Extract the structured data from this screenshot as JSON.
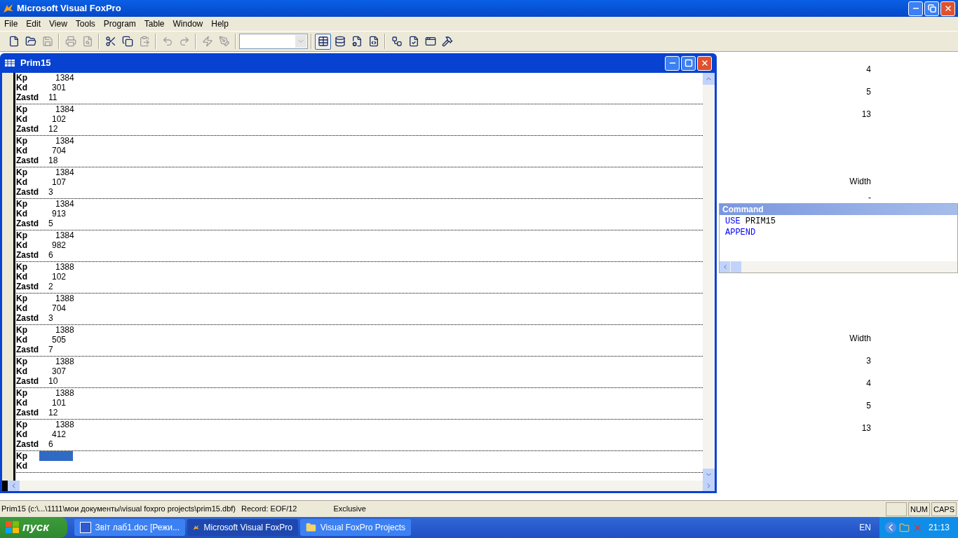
{
  "window": {
    "title": "Microsoft Visual FoxPro"
  },
  "menu": [
    "File",
    "Edit",
    "View",
    "Tools",
    "Program",
    "Table",
    "Window",
    "Help"
  ],
  "toolbar": [
    {
      "kind": "new",
      "disabled": false,
      "pressed": false
    },
    {
      "kind": "open",
      "disabled": false,
      "pressed": false
    },
    {
      "kind": "save",
      "disabled": true,
      "pressed": false
    },
    {
      "kind": "sep"
    },
    {
      "kind": "print",
      "disabled": true,
      "pressed": false
    },
    {
      "kind": "preview",
      "disabled": true,
      "pressed": false
    },
    {
      "kind": "sep"
    },
    {
      "kind": "cut",
      "disabled": false,
      "pressed": false
    },
    {
      "kind": "copy",
      "disabled": false,
      "pressed": false
    },
    {
      "kind": "paste",
      "disabled": true,
      "pressed": false
    },
    {
      "kind": "sep"
    },
    {
      "kind": "undo",
      "disabled": true,
      "pressed": false
    },
    {
      "kind": "redo",
      "disabled": true,
      "pressed": false
    },
    {
      "kind": "sep"
    },
    {
      "kind": "run",
      "disabled": true,
      "pressed": false
    },
    {
      "kind": "modify",
      "disabled": true,
      "pressed": false
    },
    {
      "kind": "sep"
    },
    {
      "kind": "combo"
    },
    {
      "kind": "sep"
    },
    {
      "kind": "grid",
      "disabled": false,
      "pressed": true
    },
    {
      "kind": "database",
      "disabled": false,
      "pressed": false
    },
    {
      "kind": "properties",
      "disabled": false,
      "pressed": false
    },
    {
      "kind": "code",
      "disabled": false,
      "pressed": false
    },
    {
      "kind": "sep"
    },
    {
      "kind": "wizard",
      "disabled": false,
      "pressed": false
    },
    {
      "kind": "form",
      "disabled": false,
      "pressed": false
    },
    {
      "kind": "report",
      "disabled": false,
      "pressed": false
    },
    {
      "kind": "tools",
      "disabled": false,
      "pressed": false
    }
  ],
  "browse": {
    "title": "Prim15",
    "records": [
      {
        "fields": [
          {
            "name": "Kp",
            "value": "1384",
            "selected": false
          },
          {
            "name": "Kd",
            "value": "301",
            "selected": false
          },
          {
            "name": "Zastd",
            "value": "11",
            "selected": false
          }
        ]
      },
      {
        "fields": [
          {
            "name": "Kp",
            "value": "1384",
            "selected": false
          },
          {
            "name": "Kd",
            "value": "102",
            "selected": false
          },
          {
            "name": "Zastd",
            "value": "12",
            "selected": false
          }
        ]
      },
      {
        "fields": [
          {
            "name": "Kp",
            "value": "1384",
            "selected": false
          },
          {
            "name": "Kd",
            "value": "704",
            "selected": false
          },
          {
            "name": "Zastd",
            "value": "18",
            "selected": false
          }
        ]
      },
      {
        "fields": [
          {
            "name": "Kp",
            "value": "1384",
            "selected": false
          },
          {
            "name": "Kd",
            "value": "107",
            "selected": false
          },
          {
            "name": "Zastd",
            "value": "3",
            "selected": false
          }
        ]
      },
      {
        "fields": [
          {
            "name": "Kp",
            "value": "1384",
            "selected": false
          },
          {
            "name": "Kd",
            "value": "913",
            "selected": false
          },
          {
            "name": "Zastd",
            "value": "5",
            "selected": false
          }
        ]
      },
      {
        "fields": [
          {
            "name": "Kp",
            "value": "1384",
            "selected": false
          },
          {
            "name": "Kd",
            "value": "982",
            "selected": false
          },
          {
            "name": "Zastd",
            "value": "6",
            "selected": false
          }
        ]
      },
      {
        "fields": [
          {
            "name": "Kp",
            "value": "1388",
            "selected": false
          },
          {
            "name": "Kd",
            "value": "102",
            "selected": false
          },
          {
            "name": "Zastd",
            "value": "2",
            "selected": false
          }
        ]
      },
      {
        "fields": [
          {
            "name": "Kp",
            "value": "1388",
            "selected": false
          },
          {
            "name": "Kd",
            "value": "704",
            "selected": false
          },
          {
            "name": "Zastd",
            "value": "3",
            "selected": false
          }
        ]
      },
      {
        "fields": [
          {
            "name": "Kp",
            "value": "1388",
            "selected": false
          },
          {
            "name": "Kd",
            "value": "505",
            "selected": false
          },
          {
            "name": "Zastd",
            "value": "7",
            "selected": false
          }
        ]
      },
      {
        "fields": [
          {
            "name": "Kp",
            "value": "1388",
            "selected": false
          },
          {
            "name": "Kd",
            "value": "307",
            "selected": false
          },
          {
            "name": "Zastd",
            "value": "10",
            "selected": false
          }
        ]
      },
      {
        "fields": [
          {
            "name": "Kp",
            "value": "1388",
            "selected": false
          },
          {
            "name": "Kd",
            "value": "101",
            "selected": false
          },
          {
            "name": "Zastd",
            "value": "12",
            "selected": false
          }
        ]
      },
      {
        "fields": [
          {
            "name": "Kp",
            "value": "1388",
            "selected": false
          },
          {
            "name": "Kd",
            "value": "412",
            "selected": false
          },
          {
            "name": "Zastd",
            "value": "6",
            "selected": false
          }
        ]
      },
      {
        "fields": [
          {
            "name": "Kp",
            "selected": true
          },
          {
            "name": "Kd",
            "selected": false
          }
        ]
      }
    ]
  },
  "background_upper": [
    {
      "text": "4",
      "kind": "value"
    },
    {
      "text": "5",
      "kind": "value"
    },
    {
      "text": "13",
      "kind": "value"
    },
    {
      "text": "Width",
      "kind": "heading"
    },
    {
      "text": "-",
      "kind": "partial"
    }
  ],
  "command": {
    "title": "Command",
    "lines": [
      [
        {
          "text": "USE",
          "kind": "keyword"
        },
        {
          "text": "PRIM15",
          "kind": "plain"
        }
      ],
      [
        {
          "text": "APPEND",
          "kind": "keyword"
        }
      ]
    ]
  },
  "background_lower": [
    {
      "text": "Width",
      "kind": "heading"
    },
    {
      "text": "3",
      "kind": "value"
    },
    {
      "text": "4",
      "kind": "value"
    },
    {
      "text": "5",
      "kind": "value"
    },
    {
      "text": "13",
      "kind": "value"
    }
  ],
  "status_bar": {
    "path": "Prim15 (c:\\...\\1111\\мои документы\\visual foxpro projects\\prim15.dbf)",
    "record": "Record: EOF/12",
    "mode": "Exclusive",
    "indicators": [
      "NUM",
      "CAPS"
    ]
  },
  "taskbar": {
    "start": "пуск",
    "tasks": [
      {
        "label": "Звіт лаб1.doc [Режи...",
        "kind": "word",
        "selected": false
      },
      {
        "label": "Microsoft Visual FoxPro",
        "kind": "fox",
        "selected": true
      },
      {
        "label": "Visual FoxPro Projects",
        "kind": "folder",
        "selected": false
      }
    ],
    "language": "EN",
    "time": "21:13"
  }
}
